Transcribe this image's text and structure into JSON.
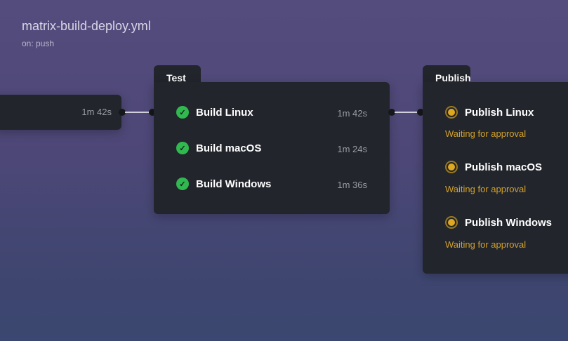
{
  "workflow": {
    "title": "matrix-build-deploy.yml",
    "trigger": "on: push"
  },
  "previous_job": {
    "duration": "1m 42s"
  },
  "test": {
    "label": "Test",
    "jobs": [
      {
        "name": "Build Linux",
        "duration": "1m 42s",
        "status": "success"
      },
      {
        "name": "Build macOS",
        "duration": "1m 24s",
        "status": "success"
      },
      {
        "name": "Build Windows",
        "duration": "1m 36s",
        "status": "success"
      }
    ]
  },
  "publish": {
    "label": "Publish",
    "jobs": [
      {
        "name": "Publish Linux",
        "status_text": "Waiting for approval"
      },
      {
        "name": "Publish macOS",
        "status_text": "Waiting for approval"
      },
      {
        "name": "Publish Windows",
        "status_text": "Waiting for approval"
      }
    ]
  },
  "colors": {
    "success": "#2fb94f",
    "waiting": "#d4a22a",
    "card": "#22252c"
  }
}
